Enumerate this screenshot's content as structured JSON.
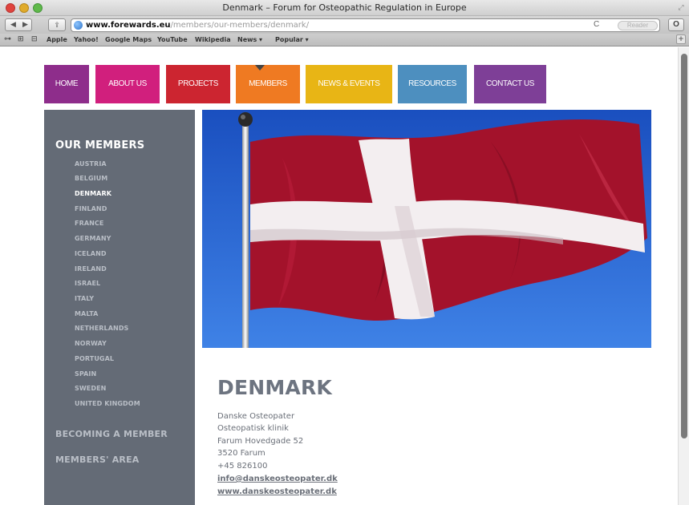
{
  "window": {
    "title": "Denmark – Forum for Osteopathic Regulation in Europe"
  },
  "toolbar": {
    "url_host": "www.forewards.eu",
    "url_path": "/members/our-members/denmark/",
    "reader_label": "Reader"
  },
  "bookmarks": [
    "Apple",
    "Yahoo!",
    "Google Maps",
    "YouTube",
    "Wikipedia",
    "News ▾",
    "Popular ▾"
  ],
  "nav": {
    "tabs": [
      {
        "label": "HOME",
        "color": "#8e2d8b"
      },
      {
        "label": "ABOUT US",
        "color": "#d11f7d"
      },
      {
        "label": "PROJECTS",
        "color": "#cc2530"
      },
      {
        "label": "MEMBERS",
        "color": "#ef7a22"
      },
      {
        "label": "NEWS & EVENTS",
        "color": "#e8b515"
      },
      {
        "label": "RESOURCES",
        "color": "#4d8fbf"
      },
      {
        "label": "CONTACT US",
        "color": "#7e3f97"
      }
    ],
    "active_index": 3
  },
  "sidebar": {
    "heading": "OUR MEMBERS",
    "countries": [
      "AUSTRIA",
      "BELGIUM",
      "DENMARK",
      "FINLAND",
      "FRANCE",
      "GERMANY",
      "ICELAND",
      "IRELAND",
      "ISRAEL",
      "ITALY",
      "MALTA",
      "NETHERLANDS",
      "NORWAY",
      "PORTUGAL",
      "SPAIN",
      "SWEDEN",
      "UNITED KINGDOM"
    ],
    "active_country": "DENMARK",
    "links": [
      "BECOMING A MEMBER",
      "MEMBERS' AREA"
    ],
    "color": "#646b76"
  },
  "content": {
    "title": "DENMARK",
    "address_lines": [
      "Danske Osteopater",
      "Osteopatisk klinik",
      "Farum Hovedgade 52",
      "3520 Farum",
      "+45 826100"
    ],
    "email": "info@danskeosteopater.dk",
    "website": "www.danskeosteopater.dk"
  },
  "flag_colors": {
    "red": "#a3122b",
    "white": "#f3eef0",
    "sky": "#2b68d8"
  }
}
